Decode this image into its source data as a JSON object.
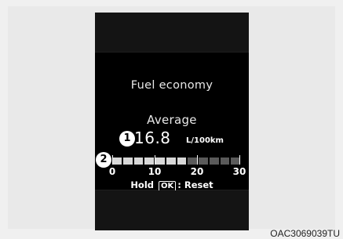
{
  "screen": {
    "title": "Fuel economy",
    "subtitle": "Average",
    "value": "16.8",
    "unit": "L/100km",
    "callout_1": "1",
    "callout_2": "2",
    "gauge": {
      "ticks": [
        "0",
        "10",
        "20",
        "30"
      ],
      "fill_fraction": 0.56
    },
    "hold_prefix": "Hold",
    "ok_label": "OK",
    "hold_suffix": ": Reset"
  },
  "caption": "OAC3069039TU",
  "colors": {
    "screen_bg": "#000000",
    "bar_on": "#d8d8d8",
    "bar_off": "#5a5a5a"
  }
}
